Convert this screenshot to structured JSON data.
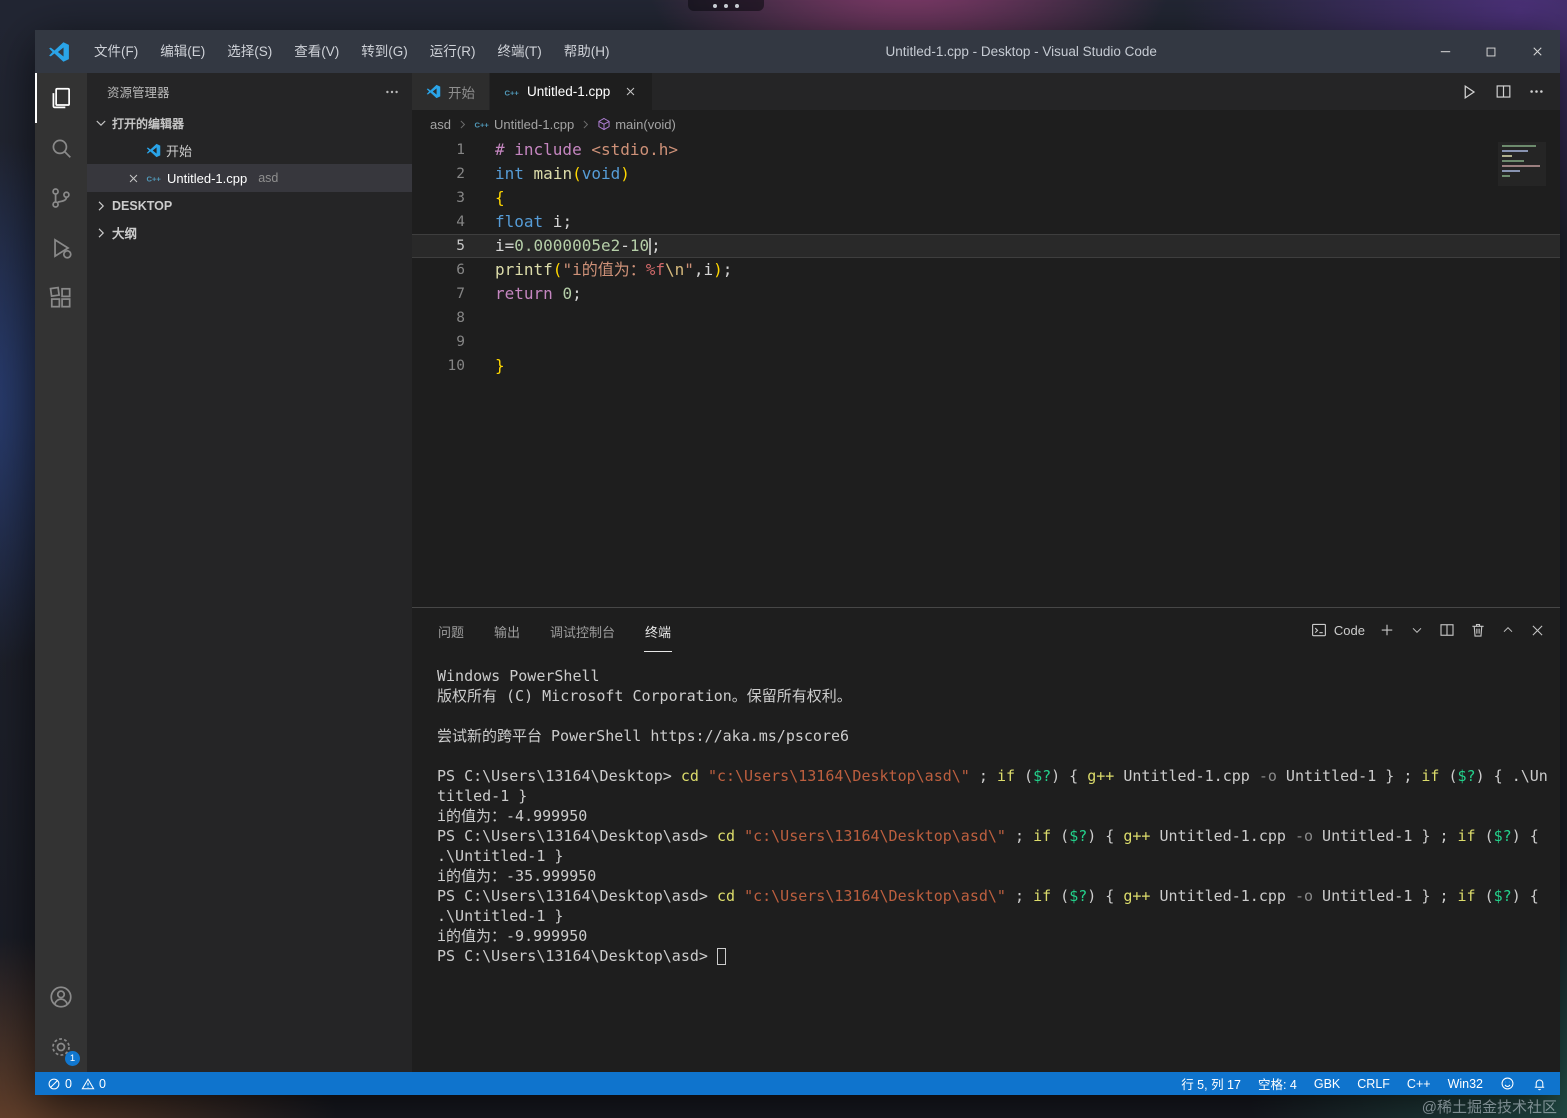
{
  "colors": {
    "statusbar": "#0f74cd",
    "activity_badge": "#1177cf",
    "title_bar": "#333842"
  },
  "icon_glyphs": {
    "cpp": "C++"
  },
  "titlebar": {
    "title": "Untitled-1.cpp - Desktop - Visual Studio Code",
    "menus": [
      "文件(F)",
      "编辑(E)",
      "选择(S)",
      "查看(V)",
      "转到(G)",
      "运行(R)",
      "终端(T)",
      "帮助(H)"
    ]
  },
  "activitybar": {
    "settings_badge": "1"
  },
  "sidebar": {
    "header": "资源管理器",
    "open_editors_label": "打开的编辑器",
    "open_editors": [
      {
        "label": "开始",
        "detail": ""
      },
      {
        "label": "Untitled-1.cpp",
        "detail": "asd"
      }
    ],
    "sections": [
      {
        "label": "DESKTOP"
      },
      {
        "label": "大纲"
      }
    ]
  },
  "editor": {
    "tabs": [
      {
        "label": "开始"
      },
      {
        "label": "Untitled-1.cpp"
      }
    ],
    "breadcrumb": [
      {
        "label": "asd"
      },
      {
        "label": "Untitled-1.cpp"
      },
      {
        "label": "main(void)"
      }
    ],
    "code_lines": [
      {
        "n": "1",
        "segs": [
          {
            "t": "# include ",
            "c": "pp"
          },
          {
            "t": "<stdio.h>",
            "c": "str"
          }
        ]
      },
      {
        "n": "2",
        "segs": [
          {
            "t": "int",
            "c": "kw"
          },
          {
            "t": " ",
            "c": "pl"
          },
          {
            "t": "main",
            "c": "fn"
          },
          {
            "t": "(",
            "c": "br"
          },
          {
            "t": "void",
            "c": "kw"
          },
          {
            "t": ")",
            "c": "br"
          }
        ]
      },
      {
        "n": "3",
        "segs": [
          {
            "t": "{",
            "c": "br"
          }
        ]
      },
      {
        "n": "4",
        "segs": [
          {
            "t": "float",
            "c": "kw"
          },
          {
            "t": " i;",
            "c": "pl"
          }
        ]
      },
      {
        "n": "5",
        "current": true,
        "segs": [
          {
            "t": "i=",
            "c": "pl"
          },
          {
            "t": "0.0000005e2",
            "c": "num"
          },
          {
            "t": "-",
            "c": "pl"
          },
          {
            "t": "10",
            "c": "num"
          },
          {
            "cursor": true
          },
          {
            "t": ";",
            "c": "pl"
          }
        ]
      },
      {
        "n": "6",
        "segs": [
          {
            "t": "printf",
            "c": "fn"
          },
          {
            "t": "(",
            "c": "br"
          },
          {
            "t": "\"i的值为：",
            "c": "str"
          },
          {
            "t": "%f",
            "c": "fmt"
          },
          {
            "t": "\\n",
            "c": "esc"
          },
          {
            "t": "\"",
            "c": "str"
          },
          {
            "t": ",i",
            "c": "pl"
          },
          {
            "t": ")",
            "c": "br"
          },
          {
            "t": ";",
            "c": "pl"
          }
        ]
      },
      {
        "n": "7",
        "segs": [
          {
            "t": "return",
            "c": "ctrl"
          },
          {
            "t": " ",
            "c": "pl"
          },
          {
            "t": "0",
            "c": "num"
          },
          {
            "t": ";",
            "c": "pl"
          }
        ]
      },
      {
        "n": "8",
        "segs": []
      },
      {
        "n": "9",
        "segs": []
      },
      {
        "n": "10",
        "segs": [
          {
            "t": "}",
            "c": "br"
          }
        ]
      }
    ]
  },
  "panel": {
    "tabs": [
      "问题",
      "输出",
      "调试控制台",
      "终端"
    ],
    "active_tab": "终端",
    "profile_label": "Code",
    "terminal_lines": [
      {
        "segs": [
          {
            "t": "Windows PowerShell",
            "c": "pl"
          }
        ]
      },
      {
        "segs": [
          {
            "t": "版权所有 (C) Microsoft Corporation。保留所有权利。",
            "c": "pl"
          }
        ]
      },
      {
        "segs": []
      },
      {
        "segs": [
          {
            "t": "尝试新的跨平台 PowerShell https://aka.ms/pscore6",
            "c": "pl"
          }
        ]
      },
      {
        "segs": []
      },
      {
        "segs": [
          {
            "t": "PS C:\\Users\\13164\\Desktop> ",
            "c": "pl"
          },
          {
            "t": "cd",
            "c": "cmd"
          },
          {
            "t": " ",
            "c": "pl"
          },
          {
            "t": "\"c:\\Users\\13164\\Desktop\\asd\\\"",
            "c": "str"
          },
          {
            "t": " ; ",
            "c": "pl"
          },
          {
            "t": "if",
            "c": "cmd"
          },
          {
            "t": " (",
            "c": "pl"
          },
          {
            "t": "$?",
            "c": "var"
          },
          {
            "t": ") { ",
            "c": "pl"
          },
          {
            "t": "g++",
            "c": "cmd"
          },
          {
            "t": " Untitled-1.cpp ",
            "c": "pl"
          },
          {
            "t": "-o",
            "c": "param"
          },
          {
            "t": " Untitled-1 } ; ",
            "c": "pl"
          },
          {
            "t": "if",
            "c": "cmd"
          },
          {
            "t": " (",
            "c": "pl"
          },
          {
            "t": "$?",
            "c": "var"
          },
          {
            "t": ") { ",
            "c": "pl"
          },
          {
            "t": ".\\Un",
            "c": "pl"
          }
        ]
      },
      {
        "segs": [
          {
            "t": "titled-1 }",
            "c": "pl"
          }
        ]
      },
      {
        "segs": [
          {
            "t": "i的值为：-4.999950",
            "c": "pl"
          }
        ]
      },
      {
        "segs": [
          {
            "t": "PS C:\\Users\\13164\\Desktop\\asd> ",
            "c": "pl"
          },
          {
            "t": "cd",
            "c": "cmd"
          },
          {
            "t": " ",
            "c": "pl"
          },
          {
            "t": "\"c:\\Users\\13164\\Desktop\\asd\\\"",
            "c": "str"
          },
          {
            "t": " ; ",
            "c": "pl"
          },
          {
            "t": "if",
            "c": "cmd"
          },
          {
            "t": " (",
            "c": "pl"
          },
          {
            "t": "$?",
            "c": "var"
          },
          {
            "t": ") { ",
            "c": "pl"
          },
          {
            "t": "g++",
            "c": "cmd"
          },
          {
            "t": " Untitled-1.cpp ",
            "c": "pl"
          },
          {
            "t": "-o",
            "c": "param"
          },
          {
            "t": " Untitled-1 } ; ",
            "c": "pl"
          },
          {
            "t": "if",
            "c": "cmd"
          },
          {
            "t": " (",
            "c": "pl"
          },
          {
            "t": "$?",
            "c": "var"
          },
          {
            "t": ") {",
            "c": "pl"
          }
        ]
      },
      {
        "segs": [
          {
            "t": ".\\Untitled-1 }",
            "c": "pl"
          }
        ]
      },
      {
        "segs": [
          {
            "t": "i的值为：-35.999950",
            "c": "pl"
          }
        ]
      },
      {
        "segs": [
          {
            "t": "PS C:\\Users\\13164\\Desktop\\asd> ",
            "c": "pl"
          },
          {
            "t": "cd",
            "c": "cmd"
          },
          {
            "t": " ",
            "c": "pl"
          },
          {
            "t": "\"c:\\Users\\13164\\Desktop\\asd\\\"",
            "c": "str"
          },
          {
            "t": " ; ",
            "c": "pl"
          },
          {
            "t": "if",
            "c": "cmd"
          },
          {
            "t": " (",
            "c": "pl"
          },
          {
            "t": "$?",
            "c": "var"
          },
          {
            "t": ") { ",
            "c": "pl"
          },
          {
            "t": "g++",
            "c": "cmd"
          },
          {
            "t": " Untitled-1.cpp ",
            "c": "pl"
          },
          {
            "t": "-o",
            "c": "param"
          },
          {
            "t": " Untitled-1 } ; ",
            "c": "pl"
          },
          {
            "t": "if",
            "c": "cmd"
          },
          {
            "t": " (",
            "c": "pl"
          },
          {
            "t": "$?",
            "c": "var"
          },
          {
            "t": ") {",
            "c": "pl"
          }
        ]
      },
      {
        "segs": [
          {
            "t": ".\\Untitled-1 }",
            "c": "pl"
          }
        ]
      },
      {
        "segs": [
          {
            "t": "i的值为：-9.999950",
            "c": "pl"
          }
        ]
      },
      {
        "segs": [
          {
            "t": "PS C:\\Users\\13164\\Desktop\\asd> ",
            "c": "pl"
          },
          {
            "cursor": true
          }
        ]
      }
    ]
  },
  "statusbar": {
    "errors": "0",
    "warnings": "0",
    "items": [
      "行 5, 列 17",
      "空格: 4",
      "GBK",
      "CRLF",
      "C++",
      "Win32"
    ]
  },
  "watermark": "@稀土掘金技术社区"
}
